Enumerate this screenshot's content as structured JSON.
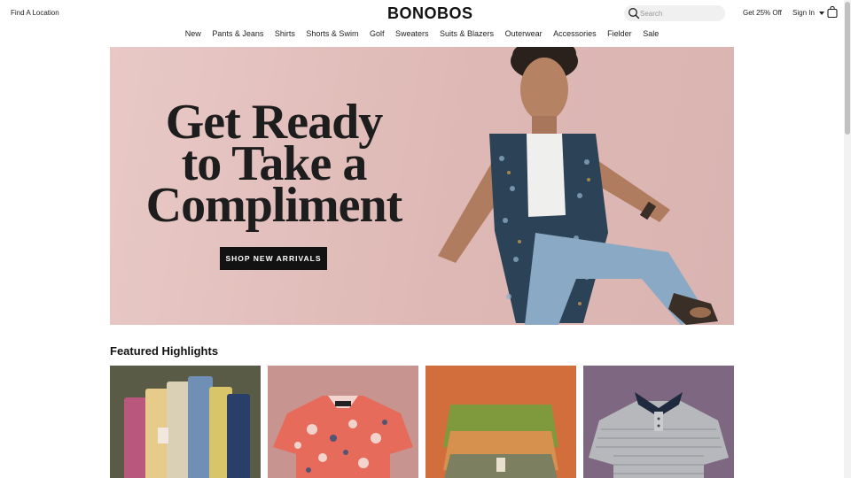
{
  "header": {
    "find_location": "Find A Location",
    "logo": "BONOBOS",
    "search_placeholder": "Search",
    "promo": "Get 25% Off",
    "sign_in": "Sign In"
  },
  "nav": {
    "items": [
      "New",
      "Pants & Jeans",
      "Shirts",
      "Shorts & Swim",
      "Golf",
      "Sweaters",
      "Suits & Blazers",
      "Outerwear",
      "Accessories",
      "Fielder",
      "Sale"
    ]
  },
  "hero": {
    "headline_lines": [
      "Get Ready",
      "to Take a",
      "Compliment"
    ],
    "cta": "SHOP NEW ARRIVALS"
  },
  "featured": {
    "title": "Featured Highlights"
  },
  "icons": {
    "search": "search-icon",
    "bag": "shopping-bag-icon",
    "caret": "chevron-down-icon"
  },
  "colors": {
    "hero_bg": "#deb8b5",
    "cta_bg": "#121212",
    "search_bg": "#f0f0f0"
  }
}
